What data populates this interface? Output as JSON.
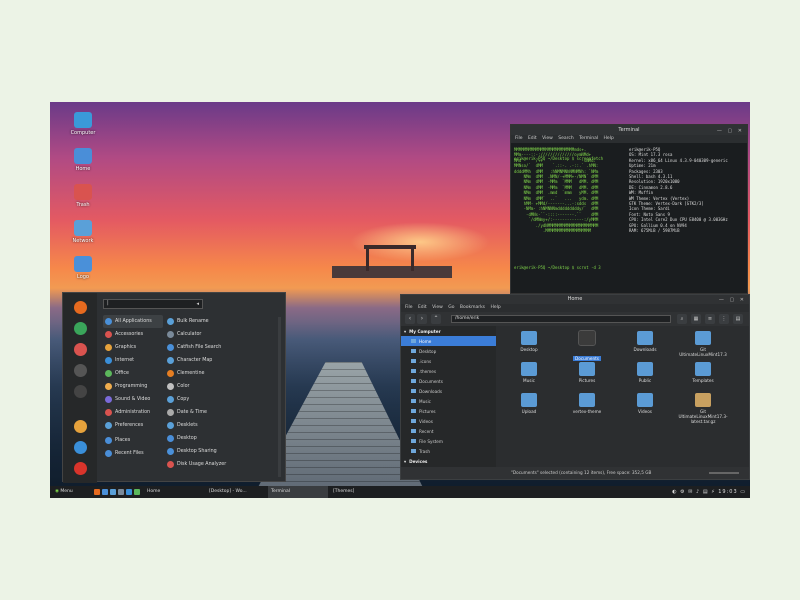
{
  "desktop_icons": [
    {
      "label": "Computer",
      "color": "#3a9ad9"
    },
    {
      "label": "Home",
      "color": "#4a8ed8"
    },
    {
      "label": "Trash",
      "color": "#d9534f"
    },
    {
      "label": "Network",
      "color": "#5aa0d8"
    },
    {
      "label": "Logo",
      "color": "#4a90d9"
    }
  ],
  "terminal": {
    "title": "Terminal",
    "menu": "File  Edit  View  Search  Terminal  Help",
    "prompt1": "erik@erik-P5Q ~/Desktop $ screenfetch",
    "logo": "MMMMMMMMMMMMMMMMMMMMMMMMMmds+.\nMMm----::-://////////////oymNMd+\nMMd      /++                -sNMd:\nMMNso/`  dMM    `.::-. .-::.` .hMN:\nddddMMh  dMM   :hNMNMNhNMNMNh: `NMm\n    NMm  dMM  .NMN/-+MMM+-/NMN` dMM\n    NMm  dMM  -MMm  `MMM   dMM. dMM\n    NMm  dMM  -MMm  `MMM   dMM. dMM\n    NMm  dMM  .mmd  `mmm   yMM. dMM\n    NMm  dMM`  ..`   ...   ydm. dMM\n    hMM- +MMd/-------...-:sdds  dMM\n    -NMm- :hNMNNNmdddddddddy/`  dMM\n     -dMNs-``-::::-------.``    dMM\n      `/dMNmy+/:-------------:/yMMM\n         ./ydNMMMMMMMMMMMMMMMMMMMMM\n            .MMMMMMMMMMMMMMMMMMM",
    "info": "erik@erik-P5Q\nOS: Mint 17.3 rosa\nKernel: x86_64 Linux 4.3.9-040309-generic\nUptime: 21m\nPackages: 2303\nShell: bash 4.3.11\nResolution: 1920x1080\nDE: Cinnamon 2.8.6\nWM: Muffin\nWM Theme: Vertex (Vertex)\nGTK Theme: Vertex-Dark [GTK2/3]\nIcon Theme: Sardi\nFont: Noto Sans 9\nCPU: Intel Core2 Duo CPU E8400 @ 3.003GHz\nGPU: Gallium 0.4 on NV94\nRAM: 675MiB / 5987MiB",
    "prompt2": "erik@erik-P5Q ~/Desktop $ scrot -d 3"
  },
  "menu": {
    "side_buttons": [
      {
        "icon": "firefox-icon",
        "color": "#e66a1f"
      },
      {
        "icon": "download-icon",
        "color": "#3aa55a"
      },
      {
        "icon": "tools-icon",
        "color": "#d9534f"
      },
      {
        "icon": "terminal-icon",
        "color": "#555"
      },
      {
        "icon": "files-icon",
        "color": "#444"
      },
      {
        "icon": "lock-icon",
        "color": "#e6a23c"
      },
      {
        "icon": "logout-icon",
        "color": "#3a8fd9"
      },
      {
        "icon": "power-icon",
        "color": "#d9342b"
      }
    ],
    "categories": [
      {
        "label": "All Applications",
        "color": "#4a90d9"
      },
      {
        "label": "Accessories",
        "color": "#d9534f"
      },
      {
        "label": "Graphics",
        "color": "#e6a23c"
      },
      {
        "label": "Internet",
        "color": "#3a8fd9"
      },
      {
        "label": "Office",
        "color": "#5cb85c"
      },
      {
        "label": "Programming",
        "color": "#f0ad4e"
      },
      {
        "label": "Sound & Video",
        "color": "#7a6ad9"
      },
      {
        "label": "Administration",
        "color": "#d9534f"
      },
      {
        "label": "Preferences",
        "color": "#5aa0d8"
      },
      {
        "label": "Places",
        "color": "#4a8ed8"
      },
      {
        "label": "Recent Files",
        "color": "#4a8ed8"
      }
    ],
    "apps": [
      {
        "label": "Bulk Rename",
        "color": "#5aa0d8"
      },
      {
        "label": "Calculator",
        "color": "#7a8a9a"
      },
      {
        "label": "Catfish File Search",
        "color": "#4a90d9"
      },
      {
        "label": "Character Map",
        "color": "#5aa0d8"
      },
      {
        "label": "Clementine",
        "color": "#e67e22"
      },
      {
        "label": "Color",
        "color": "#c0c0c0"
      },
      {
        "label": "Copy",
        "color": "#5aa0d8"
      },
      {
        "label": "Date & Time",
        "color": "#aaa"
      },
      {
        "label": "Desklets",
        "color": "#5aa0d8"
      },
      {
        "label": "Desktop",
        "color": "#4a8ed8"
      },
      {
        "label": "Desktop Sharing",
        "color": "#4a90d9"
      },
      {
        "label": "Disk Usage Analyzer",
        "color": "#d9534f"
      }
    ]
  },
  "filemanager": {
    "title": "Home",
    "menu": "File  Edit  View  Go  Bookmarks  Help",
    "path": "/home/erik",
    "sidebar": [
      {
        "label": "My Computer",
        "type": "head"
      },
      {
        "label": "Home",
        "type": "sel"
      },
      {
        "label": "Desktop",
        "type": "item"
      },
      {
        "label": ".icons",
        "type": "item"
      },
      {
        "label": ".themes",
        "type": "item"
      },
      {
        "label": "Documents",
        "type": "item"
      },
      {
        "label": "Downloads",
        "type": "item"
      },
      {
        "label": "Music",
        "type": "item"
      },
      {
        "label": "Pictures",
        "type": "item"
      },
      {
        "label": "Videos",
        "type": "item"
      },
      {
        "label": "Recent",
        "type": "item"
      },
      {
        "label": "File System",
        "type": "item"
      },
      {
        "label": "Trash",
        "type": "item"
      },
      {
        "label": "Devices",
        "type": "head"
      }
    ],
    "files": [
      {
        "label": "Desktop",
        "color": "#5b9bd5",
        "sel": false
      },
      {
        "label": "Documents",
        "color": "#3b3b3b",
        "sel": true
      },
      {
        "label": "Downloads",
        "color": "#5b9bd5",
        "sel": false
      },
      {
        "label": "Git\nUltimateLinuxMint17.3",
        "color": "#5b9bd5",
        "sel": false
      },
      {
        "label": "Music",
        "color": "#5b9bd5",
        "sel": false
      },
      {
        "label": "Pictures",
        "color": "#5b9bd5",
        "sel": false
      },
      {
        "label": "Public",
        "color": "#5b9bd5",
        "sel": false
      },
      {
        "label": "Templates",
        "color": "#5b9bd5",
        "sel": false
      },
      {
        "label": "Upload",
        "color": "#5b9bd5",
        "sel": false
      },
      {
        "label": "vertex-theme",
        "color": "#5b9bd5",
        "sel": false
      },
      {
        "label": "Videos",
        "color": "#5b9bd5",
        "sel": false
      },
      {
        "label": "Git\nUltimateLinuxMint17.3-latest.tar.gz",
        "color": "#c8a060",
        "sel": false
      }
    ],
    "status": "\"Documents\" selected (containing 12 items), Free space: 352,5 GB"
  },
  "taskbar": {
    "menu_label": "Menu",
    "windows": [
      {
        "label": "Home"
      },
      {
        "label": "[Desktop] - Wo..."
      },
      {
        "label": "Terminal"
      },
      {
        "label": "[Themes]"
      }
    ],
    "clock": "19:03"
  }
}
